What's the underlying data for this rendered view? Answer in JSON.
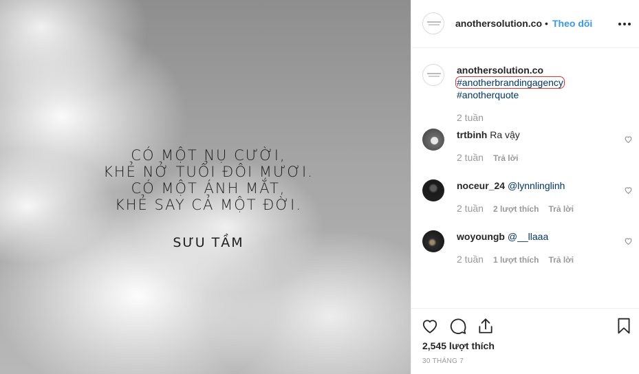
{
  "post": {
    "quote_lines": [
      "CÓ MỘT NỤ CƯỜI,",
      "KHẺ NỞ TUỔI ĐÔI MƯƠI.",
      "CÓ MỘT ÁNH MẮT,",
      "KHẺ SAY CẢ MỘT ĐỜI."
    ],
    "credit": "SƯU TẦM"
  },
  "header": {
    "username": "anothersolution.co",
    "dot": "•",
    "follow_label": "Theo dõi",
    "more_icon": "more-horizontal-icon"
  },
  "caption": {
    "username": "anothersolution.co",
    "hashtags": [
      "#anotherbrandingagency",
      "#anotherquote"
    ],
    "time": "2 tuần"
  },
  "comments": [
    {
      "username": "trtbinh",
      "text": "Ra vậy",
      "mention": "",
      "time": "2 tuần",
      "likes": "",
      "reply": "Trả lời"
    },
    {
      "username": "noceur_24",
      "text": "",
      "mention": "@lynnlinglinh",
      "time": "2 tuần",
      "likes": "2 lượt thích",
      "reply": "Trả lời"
    },
    {
      "username": "woyoungb",
      "text": "",
      "mention": "@__llaaa",
      "time": "2 tuần",
      "likes": "1 lượt thích",
      "reply": "Trả lời"
    }
  ],
  "actions": {
    "icons": [
      "heart-icon",
      "comment-icon",
      "share-icon",
      "bookmark-icon"
    ],
    "likes": "2,545 lượt thích",
    "date": "30 THÁNG 7"
  },
  "colors": {
    "link": "#3897f0",
    "hashtag": "#003569",
    "muted": "#999999",
    "highlight": "#e0312f"
  }
}
